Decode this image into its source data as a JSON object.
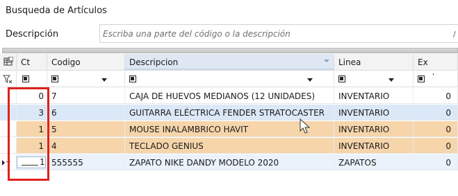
{
  "window": {
    "title": "Busqueda de Artículos"
  },
  "search": {
    "label": "Descripción",
    "placeholder": "Escriba una parte del código o la descripción"
  },
  "table": {
    "columns": [
      {
        "key": "ct",
        "label": "Ct"
      },
      {
        "key": "codigo",
        "label": "Codigo"
      },
      {
        "key": "descripcion",
        "label": "Descripcion",
        "sorted": true
      },
      {
        "key": "linea",
        "label": "Linea"
      },
      {
        "key": "ex",
        "label": "Ex"
      }
    ],
    "rows": [
      {
        "ct": "0",
        "codigo": "7",
        "descripcion": "CAJA DE HUEVOS MEDIANOS (12 UNIDADES)",
        "linea": "INVENTARIO",
        "ex": "0",
        "state": "normal"
      },
      {
        "ct": "3",
        "codigo": "6",
        "descripcion": "GUITARRA ELÉCTRICA FENDER STRATOCASTER",
        "linea": "INVENTARIO",
        "ex": "0",
        "state": "hover"
      },
      {
        "ct": "1",
        "codigo": "5",
        "descripcion": "MOUSE INALAMBRICO HAVIT",
        "linea": "INVENTARIO",
        "ex": "0",
        "state": "selected"
      },
      {
        "ct": "1",
        "codigo": "4",
        "descripcion": "TECLADO GENIUS",
        "linea": "INVENTARIO",
        "ex": "0",
        "state": "selected"
      },
      {
        "ct": "1",
        "codigo": "555555",
        "descripcion": "ZAPATO NIKE DANDY MODELO 2020",
        "linea": "ZAPATOS",
        "ex": "0",
        "state": "editing"
      }
    ]
  },
  "colors": {
    "selected_row": "#f6d5ab",
    "hover_row": "#dbe8f7",
    "annotation": "#e0201c"
  },
  "icons": {
    "column_chooser": "column-chooser-icon",
    "filter_row": "filter-icon"
  }
}
